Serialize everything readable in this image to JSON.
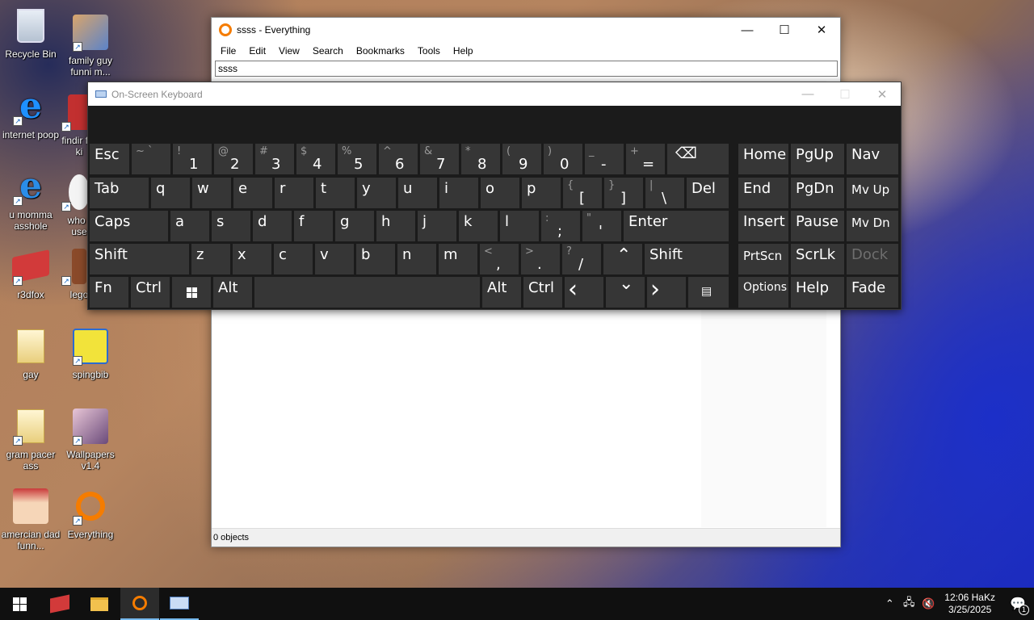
{
  "desktop": {
    "icons": [
      {
        "label": "Recycle Bin"
      },
      {
        "label": "family guy funni m..."
      },
      {
        "label": "internet poop"
      },
      {
        "label": "findir for ki"
      },
      {
        "label": "u momma asshole"
      },
      {
        "label": "who t use"
      },
      {
        "label": "r3dfox"
      },
      {
        "label": "lego"
      },
      {
        "label": "gay"
      },
      {
        "label": "spingbib"
      },
      {
        "label": "gram pacer ass"
      },
      {
        "label": "Wallpapers v1.4"
      },
      {
        "label": "amercian dad funn..."
      },
      {
        "label": "Everything"
      }
    ]
  },
  "everything_window": {
    "title": "ssss - Everything",
    "menu": [
      "File",
      "Edit",
      "View",
      "Search",
      "Bookmarks",
      "Tools",
      "Help"
    ],
    "search_value": "ssss",
    "status": "0 objects",
    "controls": {
      "minimize": "—",
      "maximize": "☐",
      "close": "✕"
    }
  },
  "osk": {
    "title": "On-Screen Keyboard",
    "keys": {
      "esc": "Esc",
      "tilde_sub": "~ `",
      "k1_sub": "!",
      "k1": "1",
      "k2_sub": "@",
      "k2": "2",
      "k3_sub": "#",
      "k3": "3",
      "k4_sub": "$",
      "k4": "4",
      "k5_sub": "%",
      "k5": "5",
      "k6_sub": "^",
      "k6": "6",
      "k7_sub": "&",
      "k7": "7",
      "k8_sub": "*",
      "k8": "8",
      "k9_sub": "(",
      "k9": "9",
      "k0_sub": ")",
      "k0": "0",
      "minus_sub": "_",
      "minus": "-",
      "equals_sub": "+",
      "equals": "=",
      "backspace": "⌫",
      "home": "Home",
      "pgup": "PgUp",
      "nav": "Nav",
      "tab": "Tab",
      "q": "q",
      "w": "w",
      "e": "e",
      "r": "r",
      "t": "t",
      "y": "y",
      "u": "u",
      "i": "i",
      "o": "o",
      "p": "p",
      "lbracket_sub": "{",
      "lbracket": "[",
      "rbracket_sub": "}",
      "rbracket": "]",
      "backslash_sub": "|",
      "backslash": "\\",
      "del": "Del",
      "end": "End",
      "pgdn": "PgDn",
      "mvup": "Mv Up",
      "caps": "Caps",
      "a": "a",
      "s": "s",
      "d": "d",
      "f": "f",
      "g": "g",
      "h": "h",
      "j": "j",
      "k": "k",
      "l": "l",
      "semicolon_sub": ":",
      "semicolon": ";",
      "quote_sub": "\"",
      "quote": "'",
      "enter": "Enter",
      "insert": "Insert",
      "pause": "Pause",
      "mvdn": "Mv Dn",
      "shift_l": "Shift",
      "z": "z",
      "x": "x",
      "c": "c",
      "v": "v",
      "b": "b",
      "n": "n",
      "m": "m",
      "comma_sub": "<",
      "comma": ",",
      "period_sub": ">",
      "period": ".",
      "slash_sub": "?",
      "slash": "/",
      "up": "⌃",
      "shift_r": "Shift",
      "prtscn": "PrtScn",
      "scrlk": "ScrLk",
      "dock": "Dock",
      "fn": "Fn",
      "ctrl_l": "Ctrl",
      "win": "⊞",
      "alt_l": "Alt",
      "space": "",
      "alt_r": "Alt",
      "ctrl_r": "Ctrl",
      "left": "‹",
      "down": "⌄",
      "right": "›",
      "menu": "▤",
      "options": "Options",
      "help": "Help",
      "fade": "Fade"
    }
  },
  "taskbar": {
    "clock_time": "12:06 HaKz",
    "clock_date": "3/25/2025",
    "notification_count": "1"
  },
  "colors": {
    "key_bg": "#363636",
    "osk_bg": "#1b1b1b",
    "taskbar_bg": "#101010",
    "accent": "#76b9ed"
  }
}
